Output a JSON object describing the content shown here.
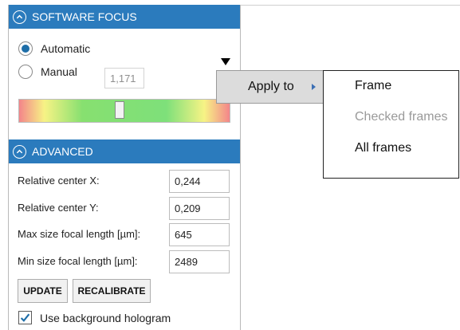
{
  "software_focus": {
    "header": "SOFTWARE FOCUS",
    "mode_automatic": "Automatic",
    "mode_manual": "Manual",
    "selected_mode": "Automatic",
    "manual_value": "1,171"
  },
  "advanced": {
    "header": "ADVANCED",
    "fields": [
      {
        "label": "Relative center X:",
        "value": "0,244"
      },
      {
        "label": "Relative center Y:",
        "value": "0,209"
      },
      {
        "label": "Max size focal length [µm]:",
        "value": "645"
      },
      {
        "label": "Min size focal length [µm]:",
        "value": "2489"
      }
    ],
    "update_label": "UPDATE",
    "recalibrate_label": "RECALIBRATE",
    "background_hologram_label": "Use background hologram",
    "background_hologram_checked": true
  },
  "context_menu": {
    "apply_to_label": "Apply to",
    "items": [
      {
        "label": "Frame",
        "enabled": true
      },
      {
        "label": "Checked frames",
        "enabled": false
      },
      {
        "label": "All frames",
        "enabled": true
      }
    ]
  },
  "colors": {
    "header_blue": "#2b7bbd",
    "radio_selected": "#1e6ea8",
    "menu_highlight": "#dcdcdc",
    "disabled_text": "#9a9a9a"
  },
  "icons": {
    "section_toggle": "chevron-up-circle-icon",
    "dropdown": "triangle-down-icon",
    "submenu_arrow": "triangle-right-icon",
    "checkbox": "checkmark-icon"
  }
}
